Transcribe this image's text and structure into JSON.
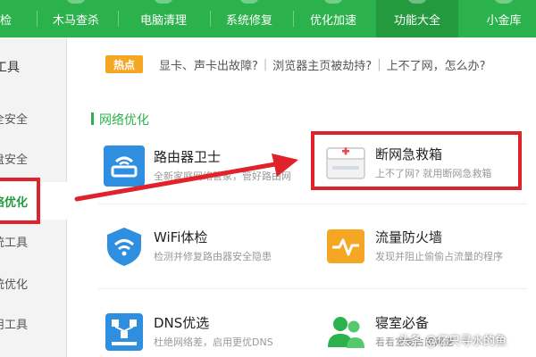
{
  "nav": {
    "tabs": [
      {
        "label": "检"
      },
      {
        "label": "木马查杀"
      },
      {
        "label": "电脑清理"
      },
      {
        "label": "系统修复"
      },
      {
        "label": "优化加速"
      },
      {
        "label": "功能大全",
        "active": true
      },
      {
        "label": "小金库"
      }
    ]
  },
  "sidebar": {
    "items": [
      {
        "label": "工具",
        "header": true
      },
      {
        "label": "全安全"
      },
      {
        "label": "盘安全"
      },
      {
        "label": "络优化",
        "active": true
      },
      {
        "label": "统工具"
      },
      {
        "label": "统优化"
      },
      {
        "label": "用工具"
      }
    ]
  },
  "hot": {
    "badge": "热点",
    "links": [
      "显卡、声卡出故障?",
      "浏览器主页被劫持?",
      "上不了网，怎么办?"
    ]
  },
  "section": {
    "title": "网络优化"
  },
  "tools": [
    {
      "name": "路由器卫士",
      "desc": "全新家庭网络管家，管好路由网",
      "icon": "router-icon",
      "color": "#2e8ee0"
    },
    {
      "name": "断网急救箱",
      "desc": "上不了网? 就用断网急救箱",
      "icon": "first-aid-kit-icon",
      "color": "#e94b4b"
    },
    {
      "name": "WiFi体检",
      "desc": "检测并修复路由器安全隐患",
      "icon": "wifi-icon",
      "color": "#2e8ee0"
    },
    {
      "name": "流量防火墙",
      "desc": "发现并阻止偷偷占流量的程序",
      "icon": "traffic-firewall-icon",
      "color": "#f5a623"
    },
    {
      "name": "DNS优选",
      "desc": "杜绝网络差，启用更优DNS",
      "icon": "dns-icon",
      "color": "#2e8ee0"
    },
    {
      "name": "寝室必备",
      "desc": "看看室友占用网速",
      "icon": "dorm-users-icon",
      "color": "#2bb24c"
    }
  ],
  "watermark": "头条 @亿只寻水的鱼",
  "colors": {
    "brand_green": "#2bb24c",
    "highlight_red": "#e0232b"
  }
}
